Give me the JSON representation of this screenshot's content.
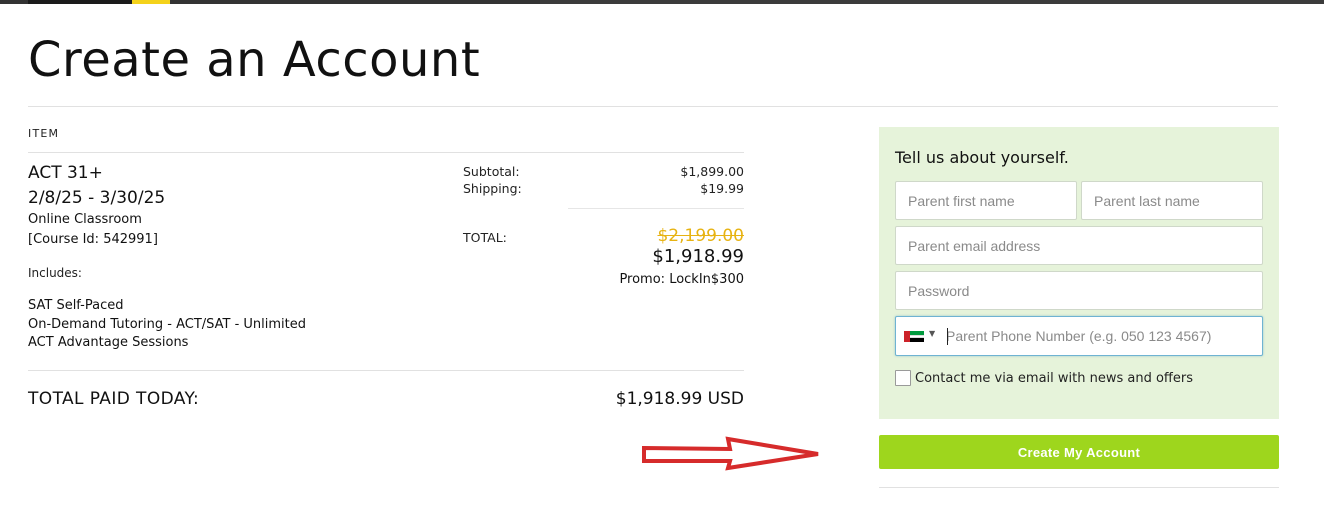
{
  "page": {
    "title": "Create an Account"
  },
  "order": {
    "item_header": "ITEM",
    "course_name": "ACT 31+",
    "course_dates": "2/8/25 - 3/30/25",
    "format": "Online Classroom",
    "course_id": "[Course Id: 542991]",
    "includes_label": "Includes:",
    "includes": [
      "SAT Self-Paced",
      "On-Demand Tutoring - ACT/SAT - Unlimited",
      "ACT Advantage Sessions"
    ],
    "subtotal_label": "Subtotal:",
    "subtotal_value": "$1,899.00",
    "shipping_label": "Shipping:",
    "shipping_value": "$19.99",
    "total_label": "TOTAL:",
    "original_price": "$2,199.00",
    "final_price": "$1,918.99",
    "promo": "Promo: LockIn$300",
    "total_paid_label": "TOTAL PAID TODAY:",
    "total_paid_value": "$1,918.99 USD"
  },
  "form": {
    "heading": "Tell us about yourself.",
    "first_name_placeholder": "Parent first name",
    "last_name_placeholder": "Parent last name",
    "email_placeholder": "Parent email address",
    "password_placeholder": "Password",
    "phone_placeholder": "Parent Phone Number (e.g. 050 123 4567)",
    "phone_country_icon": "uae-flag-icon",
    "consent_label": "Contact me via email with news and offers",
    "consent_checked": false,
    "submit_label": "Create My Account"
  },
  "colors": {
    "accent_green": "#9ed61d",
    "panel_bg": "#e6f3da",
    "strike_price": "#e7b313",
    "annotation_arrow": "#d62b2b",
    "topbar_yellow": "#f4d21a"
  }
}
